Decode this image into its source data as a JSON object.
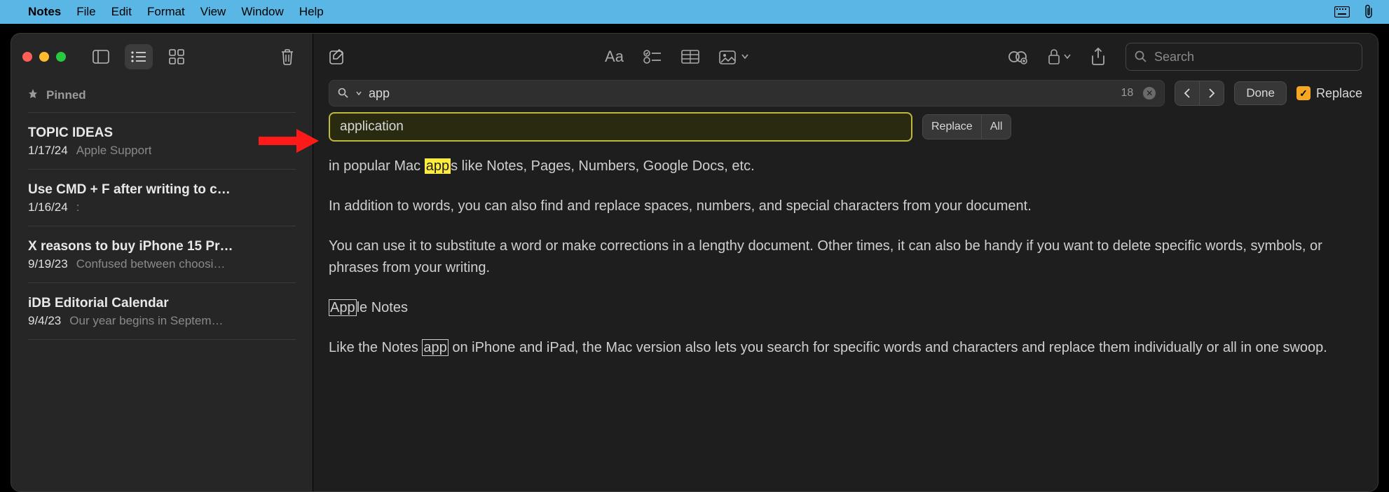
{
  "menubar": {
    "items": [
      "Notes",
      "File",
      "Edit",
      "Format",
      "View",
      "Window",
      "Help"
    ]
  },
  "sidebar": {
    "pinned_label": "Pinned",
    "notes": [
      {
        "title": "TOPIC IDEAS",
        "date": "1/17/24",
        "preview": "Apple Support"
      },
      {
        "title": "Use CMD + F after writing to c…",
        "date": "1/16/24",
        "preview": ":"
      },
      {
        "title": "X reasons to buy iPhone 15 Pr…",
        "date": "9/19/23",
        "preview": "Confused between choosi…"
      },
      {
        "title": "iDB Editorial Calendar",
        "date": "9/4/23",
        "preview": "Our year begins in Septem…"
      }
    ]
  },
  "toolbar": {
    "search_placeholder": "Search"
  },
  "find": {
    "query": "app",
    "count": "18",
    "replace_with": "application",
    "done_label": "Done",
    "replace_toggle_label": "Replace",
    "replace_btn": "Replace",
    "all_btn": "All"
  },
  "content": {
    "p1_a": "in popular Mac ",
    "p1_hl": "app",
    "p1_b": "s like Notes, Pages, Numbers, Google Docs, etc.",
    "p2": "In addition to words, you can also find and replace spaces, numbers, and special characters from your document.",
    "p3": "You can use it to substitute a word or make corrections in a lengthy document. Other times, it can also be handy if you want to delete specific words, symbols, or phrases from your writing.",
    "p4_a": "App",
    "p4_b": "le Notes",
    "p5_a": "Like the Notes ",
    "p5_hl": "app",
    "p5_b": " on iPhone and iPad, the Mac version also lets you search for specific words and characters and replace them individually or all in one swoop."
  }
}
